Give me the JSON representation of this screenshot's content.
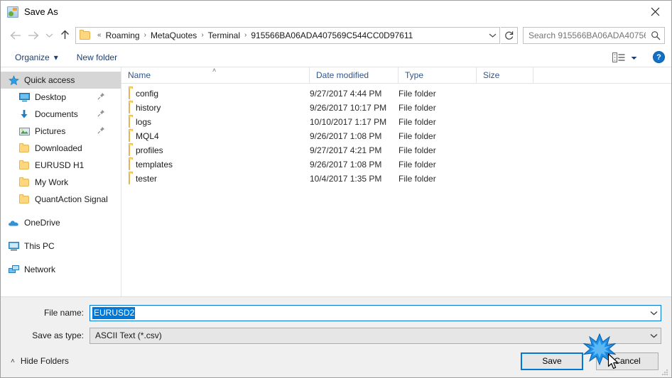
{
  "window": {
    "title": "Save As",
    "app_icon": "save-as-app-icon",
    "close_label": "✕"
  },
  "navigation": {
    "back_icon": "arrow-left-icon",
    "forward_icon": "arrow-right-icon",
    "recent_icon": "chevron-down-icon",
    "up_icon": "arrow-up-icon",
    "breadcrumb_overflow": "«",
    "breadcrumb": [
      "Roaming",
      "MetaQuotes",
      "Terminal",
      "915566BA06ADA407569C544CC0D97611"
    ],
    "breadcrumb_separator": "›",
    "dropdown_icon": "chevron-down-icon",
    "refresh_icon": "refresh-icon"
  },
  "search": {
    "placeholder": "Search 915566BA06ADA40756...",
    "value": "",
    "icon": "search-icon"
  },
  "toolbar": {
    "organize_label": "Organize",
    "organize_caret": "▾",
    "new_folder_label": "New folder",
    "view_icon": "view-layout-icon",
    "view_caret": "▾",
    "help_label": "?",
    "help_icon": "help-circle-icon"
  },
  "sidebar": {
    "groups": [
      {
        "header": {
          "label": "Quick access",
          "icon": "star-pin-icon",
          "selected": true
        },
        "items": [
          {
            "label": "Desktop",
            "icon": "desktop-icon",
            "pinned": true
          },
          {
            "label": "Documents",
            "icon": "documents-download-icon",
            "pinned": true
          },
          {
            "label": "Pictures",
            "icon": "pictures-icon",
            "pinned": true
          },
          {
            "label": "Downloaded",
            "icon": "folder-icon",
            "pinned": false
          },
          {
            "label": "EURUSD H1",
            "icon": "folder-icon",
            "pinned": false
          },
          {
            "label": "My Work",
            "icon": "folder-icon",
            "pinned": false
          },
          {
            "label": "QuantAction Signal",
            "icon": "folder-icon",
            "pinned": false
          }
        ]
      },
      {
        "header": {
          "label": "OneDrive",
          "icon": "cloud-icon",
          "selected": false
        },
        "items": []
      },
      {
        "header": {
          "label": "This PC",
          "icon": "computer-icon",
          "selected": false
        },
        "items": []
      },
      {
        "header": {
          "label": "Network",
          "icon": "network-icon",
          "selected": false
        },
        "items": []
      }
    ]
  },
  "filelist": {
    "columns": [
      {
        "label": "Name",
        "sorted": "asc",
        "sort_caret": "˄"
      },
      {
        "label": "Date modified",
        "sorted": ""
      },
      {
        "label": "Type",
        "sorted": ""
      },
      {
        "label": "Size",
        "sorted": ""
      }
    ],
    "rows": [
      {
        "name": "config",
        "date": "9/27/2017 4:44 PM",
        "type": "File folder",
        "size": "",
        "icon": "folder-icon"
      },
      {
        "name": "history",
        "date": "9/26/2017 10:17 PM",
        "type": "File folder",
        "size": "",
        "icon": "folder-icon"
      },
      {
        "name": "logs",
        "date": "10/10/2017 1:17 PM",
        "type": "File folder",
        "size": "",
        "icon": "folder-icon"
      },
      {
        "name": "MQL4",
        "date": "9/26/2017 1:08 PM",
        "type": "File folder",
        "size": "",
        "icon": "folder-icon"
      },
      {
        "name": "profiles",
        "date": "9/27/2017 4:21 PM",
        "type": "File folder",
        "size": "",
        "icon": "folder-icon"
      },
      {
        "name": "templates",
        "date": "9/26/2017 1:08 PM",
        "type": "File folder",
        "size": "",
        "icon": "folder-icon"
      },
      {
        "name": "tester",
        "date": "10/4/2017 1:35 PM",
        "type": "File folder",
        "size": "",
        "icon": "folder-icon"
      }
    ]
  },
  "form": {
    "filename_label": "File name:",
    "filename_value": "EURUSD2",
    "filename_selected": true,
    "filetype_label": "Save as type:",
    "filetype_value": "ASCII Text (*.csv)",
    "combo_caret": "⌄"
  },
  "footer": {
    "hide_folders_label": "Hide Folders",
    "hide_folders_caret": "˄",
    "save_label": "Save",
    "cancel_label": "Cancel"
  },
  "colors": {
    "accent": "#0078d7",
    "selection": "#0078d7",
    "folder": "#fcd77f",
    "link_text": "#1c3f73",
    "column_header": "#32558c",
    "footer_bg": "#f0f0f0",
    "sidebar_selected": "#d6d6d6"
  },
  "overlay": {
    "click_effect": "click-starburst",
    "cursor": "mouse-pointer"
  }
}
